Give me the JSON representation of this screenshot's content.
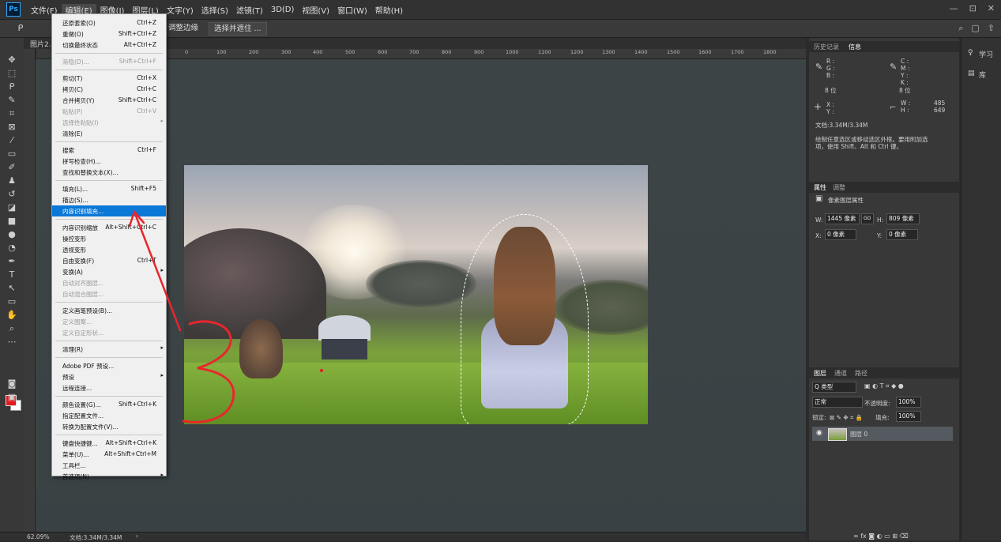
{
  "menubar": {
    "logo": "Ps",
    "items": [
      "文件(F)",
      "编辑(E)",
      "图像(I)",
      "图层(L)",
      "文字(Y)",
      "选择(S)",
      "滤镜(T)",
      "3D(D)",
      "视图(V)",
      "窗口(W)",
      "帮助(H)"
    ],
    "window_controls": [
      "—",
      "⊡",
      "✕"
    ]
  },
  "options_bar": {
    "select_mask_label": "选择并遮住 ...",
    "partial_label": "调整边缘",
    "right_icons": [
      "⌕",
      "▢",
      "⇧"
    ]
  },
  "document": {
    "tab_label": "图片2.p",
    "ruler_ticks": [
      "0",
      "100",
      "200",
      "300",
      "400",
      "500",
      "600",
      "700",
      "800",
      "900",
      "1000",
      "1100",
      "1200",
      "1300",
      "1400",
      "1500",
      "1600",
      "1700",
      "1800"
    ]
  },
  "edit_menu": {
    "items": [
      {
        "label": "还原套索(O)",
        "shortcut": "Ctrl+Z",
        "disabled": false
      },
      {
        "label": "重做(O)",
        "shortcut": "Shift+Ctrl+Z",
        "disabled": false
      },
      {
        "label": "切换最终状态",
        "shortcut": "Alt+Ctrl+Z",
        "disabled": false
      },
      {
        "sep": true
      },
      {
        "label": "渐隐(D)...",
        "shortcut": "Shift+Ctrl+F",
        "disabled": true
      },
      {
        "sep": true
      },
      {
        "label": "剪切(T)",
        "shortcut": "Ctrl+X",
        "disabled": false
      },
      {
        "label": "拷贝(C)",
        "shortcut": "Ctrl+C",
        "disabled": false
      },
      {
        "label": "合并拷贝(Y)",
        "shortcut": "Shift+Ctrl+C",
        "disabled": false
      },
      {
        "label": "粘贴(P)",
        "shortcut": "Ctrl+V",
        "disabled": true
      },
      {
        "label": "选择性粘贴(I)",
        "shortcut": "",
        "disabled": true,
        "submenu": true
      },
      {
        "label": "清除(E)",
        "shortcut": "",
        "disabled": false
      },
      {
        "sep": true
      },
      {
        "label": "搜索",
        "shortcut": "Ctrl+F",
        "disabled": false
      },
      {
        "label": "拼写检查(H)...",
        "shortcut": "",
        "disabled": false
      },
      {
        "label": "查找和替换文本(X)...",
        "shortcut": "",
        "disabled": false
      },
      {
        "sep": true
      },
      {
        "label": "填充(L)...",
        "shortcut": "Shift+F5",
        "disabled": false
      },
      {
        "label": "描边(S)...",
        "shortcut": "",
        "disabled": false
      },
      {
        "label": "内容识别填充...",
        "shortcut": "",
        "disabled": false,
        "highlight": true
      },
      {
        "sep": true
      },
      {
        "label": "内容识别缩放",
        "shortcut": "Alt+Shift+Ctrl+C",
        "disabled": false
      },
      {
        "label": "操控变形",
        "shortcut": "",
        "disabled": false
      },
      {
        "label": "透视变形",
        "shortcut": "",
        "disabled": false
      },
      {
        "label": "自由变换(F)",
        "shortcut": "Ctrl+T",
        "disabled": false
      },
      {
        "label": "变换(A)",
        "shortcut": "",
        "disabled": false,
        "submenu": true
      },
      {
        "label": "自动对齐图层...",
        "shortcut": "",
        "disabled": true
      },
      {
        "label": "自动混合图层...",
        "shortcut": "",
        "disabled": true
      },
      {
        "sep": true
      },
      {
        "label": "定义画笔预设(B)...",
        "shortcut": "",
        "disabled": false
      },
      {
        "label": "定义图案...",
        "shortcut": "",
        "disabled": true
      },
      {
        "label": "定义自定形状...",
        "shortcut": "",
        "disabled": true
      },
      {
        "sep": true
      },
      {
        "label": "清理(R)",
        "shortcut": "",
        "disabled": false,
        "submenu": true
      },
      {
        "sep": true
      },
      {
        "label": "Adobe PDF 预设...",
        "shortcut": "",
        "disabled": false
      },
      {
        "label": "预设",
        "shortcut": "",
        "disabled": false,
        "submenu": true
      },
      {
        "label": "远程连接...",
        "shortcut": "",
        "disabled": false
      },
      {
        "sep": true
      },
      {
        "label": "颜色设置(G)...",
        "shortcut": "Shift+Ctrl+K",
        "disabled": false
      },
      {
        "label": "指定配置文件...",
        "shortcut": "",
        "disabled": false
      },
      {
        "label": "转换为配置文件(V)...",
        "shortcut": "",
        "disabled": false
      },
      {
        "sep": true
      },
      {
        "label": "键盘快捷键...",
        "shortcut": "Alt+Shift+Ctrl+K",
        "disabled": false
      },
      {
        "label": "菜单(U)...",
        "shortcut": "Alt+Shift+Ctrl+M",
        "disabled": false
      },
      {
        "label": "工具栏...",
        "shortcut": "",
        "disabled": false
      },
      {
        "label": "首选项(N)",
        "shortcut": "",
        "disabled": false,
        "submenu": true
      }
    ]
  },
  "info_panel": {
    "tabs": [
      "历史记录",
      "信息"
    ],
    "rgb_block": "R :\nG :\nB :",
    "cmyk_block": "C :\nM :\nY :\nK :",
    "bit_left": "8 位",
    "bit_right": "8 位",
    "xy_block": "X :\nY :",
    "wh_labels": "W :\nH :",
    "wh_values": "485\n649",
    "doc_size": "文档:3.34M/3.34M",
    "hint": "绘制任意选区或移动选区外框。要用附加选\n项，使用 Shift、Alt 和 Ctrl 键。"
  },
  "properties_panel": {
    "tabs": [
      "属性",
      "调整"
    ],
    "title": "像素图层属性",
    "w_label": "W:",
    "w_value": "1445 像素",
    "link_icon": "GO",
    "h_label": "H:",
    "h_value": "809 像素",
    "x_label": "X:",
    "x_value": "0 像素",
    "y_label": "Y:",
    "y_value": "0 像素"
  },
  "layers_panel": {
    "tabs": [
      "图层",
      "通道",
      "路径"
    ],
    "filter_label": "Q 类型",
    "blend_mode": "正常",
    "opacity_label": "不透明度:",
    "opacity_value": "100%",
    "lock_label": "锁定:",
    "fill_label": "填充:",
    "fill_value": "100%",
    "layer_name": "图层 0"
  },
  "right_strip": {
    "learn": "学习",
    "library": "库"
  },
  "status": {
    "zoom": "62.09%",
    "doc": "文档:3.34M/3.34M"
  },
  "colors": {
    "foreground": "#e11b22",
    "background": "#ffffff",
    "highlight": "#0a78d7",
    "annotation": "#e8262c"
  }
}
